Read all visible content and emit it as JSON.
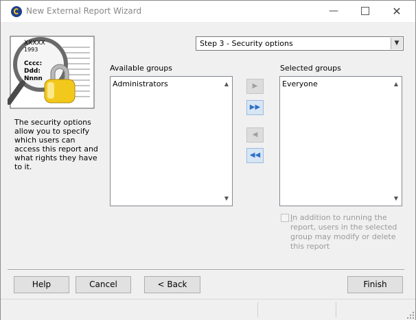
{
  "window": {
    "title": "New External Report Wizard",
    "minimize_label": "—",
    "close_label": "✕"
  },
  "illustration": {
    "doc_lines": [
      "XXXXX",
      "1993",
      "Cccc:",
      "Ddd:",
      "Nnnn"
    ]
  },
  "description": "The security options allow you to specify which users can access this report and what rights they have to it.",
  "step_select": {
    "value": "Step 3 - Security options",
    "arrow": "▼"
  },
  "available_groups": {
    "label": "Available groups",
    "items": [
      "Administrators"
    ]
  },
  "selected_groups": {
    "label": "Selected groups",
    "items": [
      "Everyone"
    ]
  },
  "move_buttons": {
    "add_one": "▶",
    "add_all": "▶▶",
    "remove_one": "◀",
    "remove_all": "◀◀"
  },
  "scroll": {
    "up": "▲",
    "down": "▼"
  },
  "modify_checkbox": {
    "checked": false,
    "label_underlined": "I",
    "label_rest": "n addition to running the report, users in the selected group may modify or delete this report"
  },
  "buttons": {
    "help": "Help",
    "cancel": "Cancel",
    "back": "< Back",
    "finish": "Finish"
  }
}
